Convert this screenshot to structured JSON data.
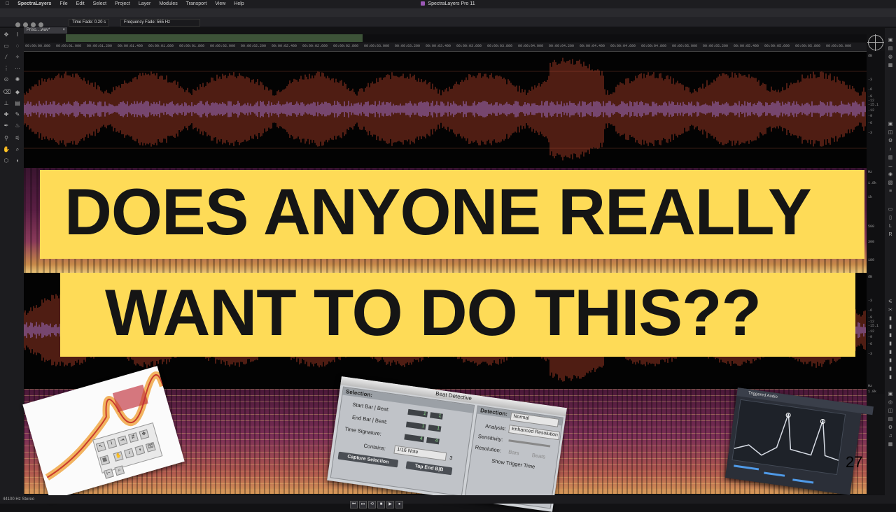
{
  "menubar": {
    "app": "SpectraLayers",
    "items": [
      "File",
      "Edit",
      "Select",
      "Project",
      "Layer",
      "Modules",
      "Transport",
      "View",
      "Help"
    ],
    "window_title": "SpectraLayers Pro 11"
  },
  "options": {
    "time_fade": "Time Fade: 0.20 s",
    "frequency_fade": "Frequency Fade: 565 Hz"
  },
  "document_tab": {
    "label": "Priso....wav*",
    "close": "×"
  },
  "ruler_ticks": [
    "00:00:00.800",
    "00:00:01.000",
    "00:00:01.200",
    "00:00:01.400",
    "00:00:01.600",
    "00:00:01.800",
    "00:00:02.000",
    "00:00:02.200",
    "00:00:02.400",
    "00:00:02.600",
    "00:00:02.800",
    "00:00:03.000",
    "00:00:03.200",
    "00:00:03.400",
    "00:00:03.600",
    "00:00:03.800",
    "00:00:04.000",
    "00:00:04.200",
    "00:00:04.400",
    "00:00:04.600",
    "00:00:04.800",
    "00:00:05.000",
    "00:00:05.200",
    "00:00:05.400",
    "00:00:05.600",
    "00:00:05.800",
    "00:00:06.000"
  ],
  "db_labels_top": [
    "dB",
    "-3",
    "-6",
    "-9",
    "-12",
    "-15.1",
    "-12",
    "-9",
    "-6",
    "-3"
  ],
  "hz_labels": [
    "Hz",
    "1.8k",
    "1k",
    "500",
    "300",
    "180"
  ],
  "db_labels_mid": [
    "dB",
    "-3",
    "-6",
    "-9",
    "-12",
    "-15.1",
    "-12",
    "-9",
    "-6",
    "-3"
  ],
  "hz_labels_bottom": [
    "Hz",
    "1.8k",
    "1k",
    "500",
    "300",
    "180"
  ],
  "headline": {
    "line1": "DOES ANYONE REALLY",
    "line2": "WANT TO DO THIS??"
  },
  "beat_detective": {
    "title": "Beat Detective",
    "selection_header": "Selection:",
    "start_label": "Start Bar | Beat:",
    "start_bar": "1",
    "start_beat": "1",
    "end_label": "End Bar | Beat:",
    "end_bar": "1",
    "end_beat": "1",
    "sig_label": "Time Signature:",
    "sig_num": "4",
    "sig_den": "4",
    "contains_label": "Contains:",
    "contains_value": "1/16 Note",
    "contains_count": "3",
    "capture_button": "Capture Selection",
    "tap_button": "Tap End B|B",
    "detection_header": "Detection:",
    "detection_value": "Normal",
    "analysis_label": "Analysis:",
    "analysis_value": "Enhanced Resolution",
    "sensitivity_label": "Sensitivity:",
    "resolution_label": "Resolution:",
    "res_bars": "Bars",
    "res_beats": "Beats",
    "show_trigger": "Show Trigger Time"
  },
  "plugin_window": {
    "title": "Triggered Audio"
  },
  "status": {
    "sample_rate": "44100 Hz Stereo"
  },
  "timecode_fragment": "27",
  "transport": [
    "⏮",
    "⏭",
    "⟲",
    "■",
    "▶",
    "●"
  ]
}
